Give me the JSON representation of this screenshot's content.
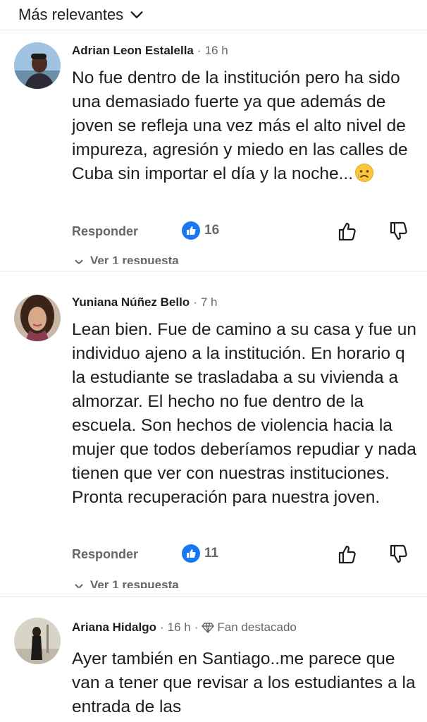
{
  "header": {
    "sort_label": "Más relevantes"
  },
  "comments": [
    {
      "author": "Adrian Leon Estalella",
      "time": "16 h",
      "text": "No fue dentro de la institución pero ha sido una demasiado fuerte ya que además de joven se refleja una vez más el alto nivel de impureza, agresión y miedo en las calles de Cuba sin importar el día y la noche...",
      "emoji": "sad-tear-face",
      "reply_label": "Responder",
      "reaction_count": "16",
      "view_replies": "Ver 1 respuesta"
    },
    {
      "author": "Yuniana Núñez Bello",
      "time": "7 h",
      "text": "Lean bien. Fue de camino a su casa y fue un individuo ajeno a la institución. En horario q la estudiante se trasladaba a su vivienda a almorzar. El hecho no fue dentro de la escuela. Son hechos de violencia hacia la mujer que todos deberíamos repudiar y nada tienen que ver con nuestras instituciones. Pronta recuperación para nuestra joven.",
      "reply_label": "Responder",
      "reaction_count": "11",
      "view_replies": "Ver 1 respuesta"
    },
    {
      "author": "Ariana Hidalgo",
      "time": "16 h",
      "badge": "Fan destacado",
      "text": "Ayer también en Santiago..me parece que van a tener que revisar a los estudiantes a la entrada  de las"
    }
  ],
  "colors": {
    "accent": "#1877f2",
    "secondary_text": "#65676b",
    "text": "#1c1e21"
  }
}
